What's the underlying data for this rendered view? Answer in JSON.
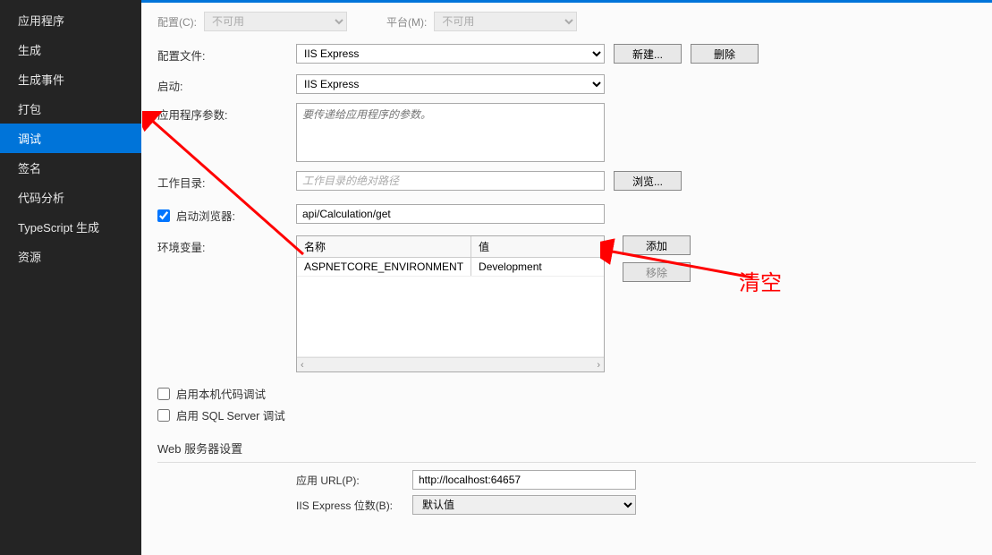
{
  "sidebar": {
    "items": [
      {
        "label": "应用程序",
        "active": false
      },
      {
        "label": "生成",
        "active": false
      },
      {
        "label": "生成事件",
        "active": false
      },
      {
        "label": "打包",
        "active": false
      },
      {
        "label": "调试",
        "active": true
      },
      {
        "label": "签名",
        "active": false
      },
      {
        "label": "代码分析",
        "active": false
      },
      {
        "label": "TypeScript 生成",
        "active": false
      },
      {
        "label": "资源",
        "active": false
      }
    ]
  },
  "topbar": {
    "config_label": "配置(C):",
    "config_value": "不可用",
    "platform_label": "平台(M):",
    "platform_value": "不可用"
  },
  "labels": {
    "profile": "配置文件:",
    "launch": "启动:",
    "app_args": "应用程序参数:",
    "workdir": "工作目录:",
    "launch_browser": "启动浏览器:",
    "env_vars": "环境变量:",
    "native_debug": "启用本机代码调试",
    "sql_debug": "启用 SQL Server 调试",
    "webserver_section": "Web 服务器设置",
    "app_url": "应用 URL(P):",
    "iis_bits": "IIS Express 位数(B):"
  },
  "buttons": {
    "new": "新建...",
    "delete": "删除",
    "browse": "浏览...",
    "add": "添加",
    "remove": "移除"
  },
  "values": {
    "profile": "IIS Express",
    "launch": "IIS Express",
    "args_placeholder": "要传递给应用程序的参数。",
    "workdir_placeholder": "工作目录的绝对路径",
    "browser_url": "api/Calculation/get",
    "app_url": "http://localhost:64657",
    "iis_bits": "默认值"
  },
  "env_table": {
    "col_name": "名称",
    "col_value": "值",
    "rows": [
      {
        "name": "ASPNETCORE_ENVIRONMENT",
        "value": "Development"
      }
    ]
  },
  "annotations": {
    "clear_text": "清空"
  }
}
